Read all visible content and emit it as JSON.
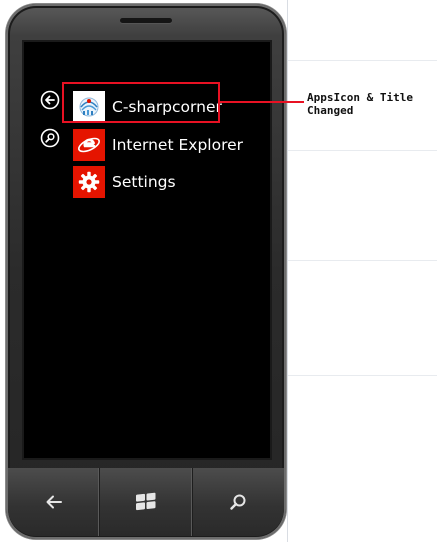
{
  "apps": [
    {
      "label": "C-sharpcorner",
      "icon": "csharpcorner-logo-icon"
    },
    {
      "label": "Internet Explorer",
      "icon": "internet-explorer-icon"
    },
    {
      "label": "Settings",
      "icon": "gear-icon"
    }
  ],
  "side_icons": [
    "back-arrow-icon",
    "search-icon"
  ],
  "hardware_buttons": [
    "back-icon",
    "windows-icon",
    "search-icon"
  ],
  "annotation": {
    "line1": "AppsIcon & Title",
    "line2": "Changed"
  },
  "colors": {
    "accent_red": "#e51400",
    "highlight_red": "#e81123",
    "screen_bg": "#000000"
  }
}
